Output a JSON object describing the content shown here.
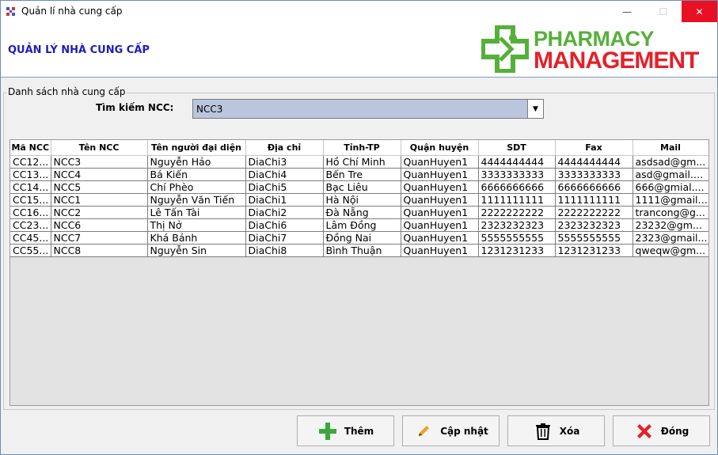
{
  "window": {
    "title": "Quản lí nhà cung cấp",
    "min_glyph": "—",
    "max_glyph": "☐",
    "close_glyph": "✕"
  },
  "header": {
    "page_title": "QUẢN LÝ NHÀ CUNG CẤP",
    "logo_line1": "PHARMACY",
    "logo_line2": "MANAGEMENT"
  },
  "group": {
    "legend": "Danh sách nhà cung cấp",
    "search_label": "Tìm kiếm NCC:",
    "search_value": "NCC3",
    "dropdown_glyph": "▼"
  },
  "table": {
    "columns": [
      "Mã NCC",
      "Tên NCC",
      "Tên người đại diện",
      "Địa chỉ",
      "Tỉnh-TP",
      "Quận huyện",
      "SDT",
      "Fax",
      "Mail"
    ],
    "rows": [
      [
        "CC12...",
        "NCC3",
        "Nguyễn Hảo",
        "DiaChi3",
        "Hồ Chí Minh",
        "QuanHuyen1",
        "4444444444",
        "4444444444",
        "asdsad@gm..."
      ],
      [
        "CC13...",
        "NCC4",
        "Bá Kiến",
        "DiaChi4",
        "Bến Tre",
        "QuanHuyen1",
        "3333333333",
        "3333333333",
        "asd@gmail.c..."
      ],
      [
        "CC14...",
        "NCC5",
        "Chí Phèo",
        "DiaChi5",
        "Bạc Liêu",
        "QuanHuyen1",
        "6666666666",
        "6666666666",
        "666@gmial...."
      ],
      [
        "CC15...",
        "NCC1",
        "Nguyễn Văn Tiến",
        "DiaChi1",
        "Hà Nội",
        "QuanHuyen1",
        "1111111111",
        "1111111111",
        "1111@gmail...."
      ],
      [
        "CC16...",
        "NCC2",
        "Lê Tấn Tài",
        "DiaChi2",
        "Đà Nẵng",
        "QuanHuyen1",
        "2222222222",
        "2222222222",
        "trancong@g..."
      ],
      [
        "CC23...",
        "NCC6",
        "Thị Nở",
        "DiaChi6",
        "Lâm Đồng",
        "QuanHuyen1",
        "2323232323",
        "2323232323",
        "23232@gm..."
      ],
      [
        "CC45...",
        "NCC7",
        "Khá Bảnh",
        "DiaChi7",
        "Đồng Nai",
        "QuanHuyen1",
        "5555555555",
        "5555555555",
        "2323@gmail..."
      ],
      [
        "CC55...",
        "NCC8",
        "Nguyễn Sin",
        "DiaChi8",
        "Bình Thuận",
        "QuanHuyen1",
        "1231231233",
        "1231231233",
        "qweqw@gm..."
      ]
    ]
  },
  "buttons": {
    "add": "Thêm",
    "update": "Cập nhật",
    "delete": "Xóa",
    "close": "Đóng"
  },
  "colors": {
    "title_blue": "#1c1cc0",
    "logo_green": "#55b03a",
    "logo_red": "#e5202a",
    "combo_bg": "#b9c6dd",
    "close_red": "#e81123"
  },
  "icons": {
    "add": "plus-icon",
    "update": "pencil-icon",
    "delete": "trash-icon",
    "close": "x-icon",
    "logo": "pharmacy-cross-icon"
  }
}
